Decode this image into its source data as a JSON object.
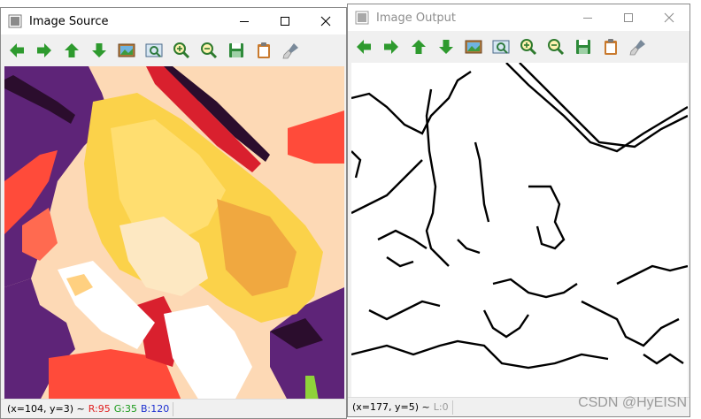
{
  "source_window": {
    "title": "Image Source",
    "status": {
      "coords": "(x=104, y=3) ~",
      "r": "R:95",
      "g": "G:35",
      "b": "B:120",
      "r_color": "#e02020",
      "g_color": "#1a9a1a",
      "b_color": "#1c2fd0"
    }
  },
  "output_window": {
    "title": "Image Output",
    "status": {
      "coords": "(x=177, y=5) ~",
      "l": "L:0"
    }
  },
  "toolbar_icons": [
    "pan-left-icon",
    "pan-right-icon",
    "pan-up-icon",
    "pan-down-icon",
    "zoom-to-fit-icon",
    "zoom-original-icon",
    "zoom-in-icon",
    "zoom-out-icon",
    "save-image-icon",
    "copy-clipboard-icon",
    "properties-brush-icon"
  ],
  "watermark": "CSDN @HyEISN",
  "colors": {
    "arrow_green": "#2e9a2e",
    "purple": "#5e2478",
    "yellow": "#fbd24a",
    "red": "#ff4b3a",
    "peach": "#fdd9b5"
  }
}
